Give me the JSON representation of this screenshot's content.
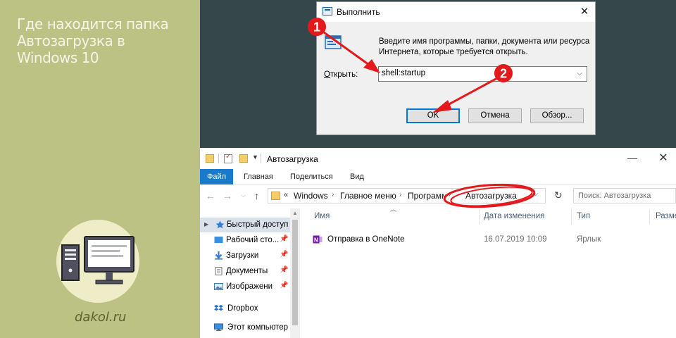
{
  "article": {
    "title_lines": [
      "Где находится папка",
      "Автозагрузка в",
      "Windows 10"
    ],
    "site": "dakol.ru"
  },
  "run_dialog": {
    "title": "Выполнить",
    "close_glyph": "✕",
    "description": "Введите имя программы, папки, документа или ресурса Интернета, которые требуется открыть.",
    "open_label": "Открыть:",
    "open_label_hotkey": "О",
    "open_label_rest": "ткрыть:",
    "input_value": "shell:startup",
    "buttons": {
      "ok": "OK",
      "cancel": "Отмена",
      "browse": "Обзор..."
    }
  },
  "explorer": {
    "title": "Автозагрузка",
    "ribbon_tabs": [
      "Файл",
      "Главная",
      "Поделиться",
      "Вид"
    ],
    "address": {
      "prefix": "«",
      "crumbs": [
        "Windows",
        "Главное меню",
        "Программы",
        "Автозагрузка"
      ],
      "separator": "›"
    },
    "search_placeholder": "Поиск: Автозагрузка",
    "nav": {
      "quick_access": "Быстрый доступ",
      "items": [
        "Рабочий сто...",
        "Загрузки",
        "Документы",
        "Изображени"
      ],
      "dropbox": "Dropbox",
      "this_pc": "Этот компьютер"
    },
    "columns": [
      "Имя",
      "Дата изменения",
      "Тип",
      "Разме"
    ],
    "files": [
      {
        "name": "Отправка в OneNote",
        "date": "16.07.2019 10:09",
        "type": "Ярлык"
      }
    ]
  },
  "annotations": {
    "badge_1": "1",
    "badge_2": "2",
    "badge_color": "#e3191c",
    "arrow_color": "#e3191c"
  },
  "colors": {
    "left_panel": "#bcc184",
    "dark_background": "#36474c",
    "ribbon_file_tab": "#1979ca",
    "focus_border": "#0078d7"
  },
  "icons": {
    "run_app": "run-dialog-icon",
    "run_big": "run-program-icon",
    "qa_folder": "folder-icon",
    "qa_properties": "properties-icon",
    "nav_back": "arrow-left-icon",
    "nav_forward": "arrow-right-icon",
    "nav_up": "arrow-up-icon",
    "refresh": "refresh-icon",
    "file": "onenote-icon",
    "logo": "computer-icon"
  }
}
